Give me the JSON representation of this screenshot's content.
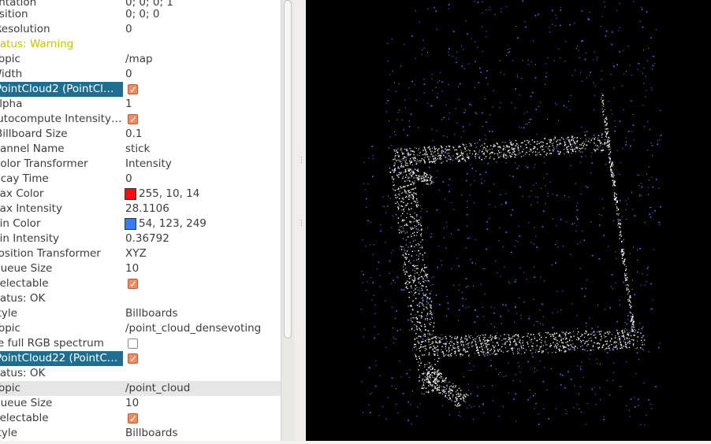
{
  "rows": [
    {
      "label": "Orientation",
      "value": "0; 0; 0; 1"
    },
    {
      "label": "Position",
      "value": "0; 0; 0"
    },
    {
      "label": "Resolution",
      "value": "0"
    },
    {
      "label": "Status: Warning",
      "value": ""
    },
    {
      "label": "Topic",
      "value": "/map"
    },
    {
      "label": "Width",
      "value": "0"
    },
    {
      "label": "PointCloud2 (PointCl…",
      "checkbox": true
    },
    {
      "label": "Alpha",
      "value": "1"
    },
    {
      "label": "Autocompute Intensity…",
      "checkbox": true
    },
    {
      "label": "Billboard Size",
      "value": "0.1"
    },
    {
      "label": "Channel Name",
      "value": "stick"
    },
    {
      "label": "Color Transformer",
      "value": "Intensity"
    },
    {
      "label": "Decay Time",
      "value": "0"
    },
    {
      "label": "Max Color",
      "value": "255, 10, 14",
      "swatch": "#ff0a0e"
    },
    {
      "label": "Max Intensity",
      "value": "28.1106"
    },
    {
      "label": "Min Color",
      "value": "54, 123, 249",
      "swatch": "#367bf9"
    },
    {
      "label": "Min Intensity",
      "value": "0.36792"
    },
    {
      "label": "Position Transformer",
      "value": "XYZ"
    },
    {
      "label": "Queue Size",
      "value": "10"
    },
    {
      "label": "Selectable",
      "checkbox": true
    },
    {
      "label": "Status: OK",
      "value": ""
    },
    {
      "label": "Style",
      "value": "Billboards"
    },
    {
      "label": "Topic",
      "value": "/point_cloud_densevoting"
    },
    {
      "label": "Use full RGB spectrum",
      "checkbox": false
    },
    {
      "label": "PointCloud22 (PointC…",
      "checkbox": true
    },
    {
      "label": "Status: OK",
      "value": ""
    },
    {
      "label": "Topic",
      "value": "/point_cloud"
    },
    {
      "label": "Queue Size",
      "value": "10"
    },
    {
      "label": "Selectable",
      "checkbox": true
    },
    {
      "label": "Style",
      "value": "Billboards"
    }
  ],
  "colors": {
    "warning_text": "#c4c400",
    "group_header_bg": "#1f6e8f",
    "checkbox_on": "#f08b62",
    "viewport_bg": "#000000",
    "cloud_white": "#ffffff",
    "cloud_blue": "#5a6cff"
  }
}
